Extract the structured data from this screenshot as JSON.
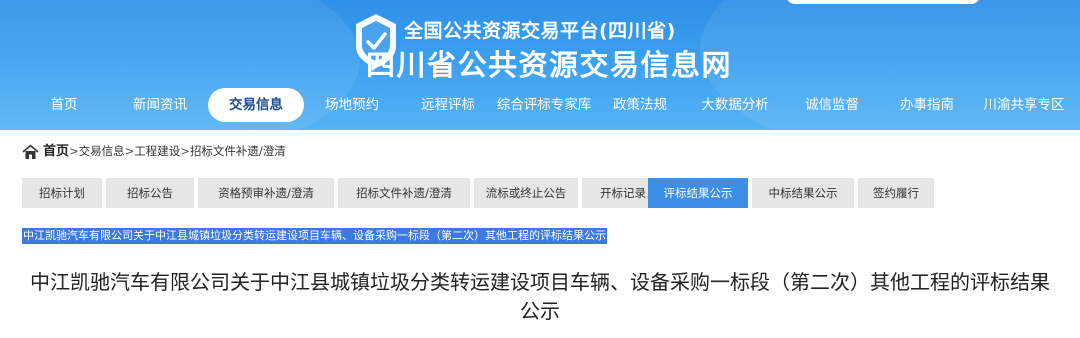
{
  "header": {
    "sub_title": "全国公共资源交易平台(四川省)",
    "main_title": "四川省公共资源交易信息网"
  },
  "nav": {
    "items": [
      {
        "label": "首页",
        "active": false
      },
      {
        "label": "新闻资讯",
        "active": false
      },
      {
        "label": "交易信息",
        "active": true
      },
      {
        "label": "场地预约",
        "active": false
      },
      {
        "label": "远程评标",
        "active": false
      },
      {
        "label": "综合评标专家库",
        "active": false
      },
      {
        "label": "政策法规",
        "active": false
      },
      {
        "label": "大数据分析",
        "active": false
      },
      {
        "label": "诚信监督",
        "active": false
      },
      {
        "label": "办事指南",
        "active": false
      },
      {
        "label": "川渝共享专区",
        "active": false
      }
    ]
  },
  "breadcrumb": {
    "home": "首页",
    "sep": ">",
    "items": [
      "交易信息",
      "工程建设",
      "招标文件补遗/澄清"
    ]
  },
  "tabs": [
    {
      "label": "招标计划",
      "active": false
    },
    {
      "label": "招标公告",
      "active": false
    },
    {
      "label": "资格预审补遗/澄清",
      "active": false
    },
    {
      "label": "招标文件补遗/澄清",
      "active": false
    },
    {
      "label": "流标或终止公告",
      "active": false
    },
    {
      "label": "开标记录",
      "active": false
    },
    {
      "label": "评标结果公示",
      "active": true
    },
    {
      "label": "中标结果公示",
      "active": false
    },
    {
      "label": "签约履行",
      "active": false
    }
  ],
  "selected_link": "中江凯驰汽车有限公司关于中江县城镇垃圾分类转运建设项目车辆、设备采购一标段（第二次）其他工程的评标结果公示",
  "notice_title": "中江凯驰汽车有限公司关于中江县城镇垃圾分类转运建设项目车辆、设备采购一标段（第二次）其他工程的评标结果公示",
  "colors": {
    "banner": "#3b9ff0",
    "active_tab": "#3d8ee6",
    "selection": "#3d7ae0"
  }
}
